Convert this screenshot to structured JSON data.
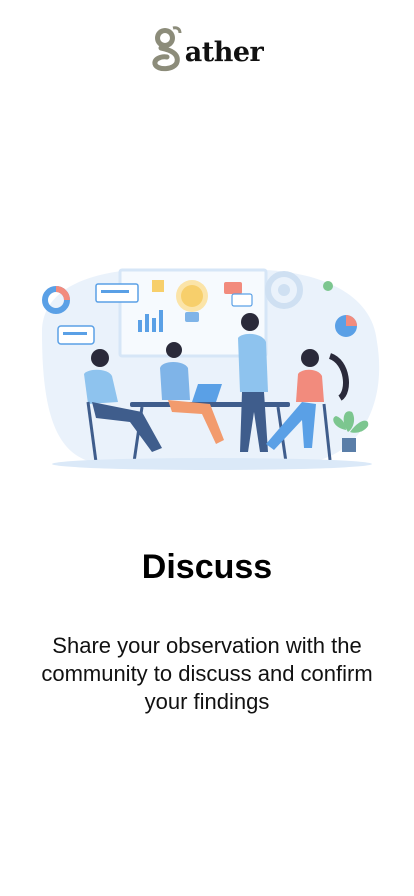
{
  "brand": {
    "logo_text": "ather",
    "logo_icon": "g-letter-logo-icon"
  },
  "onboarding": {
    "title": "Discuss",
    "description": "Share your observation with the community to discuss and confirm your findings",
    "illustration": "team-meeting-illustration"
  },
  "colors": {
    "logo_gray": "#8c8c7a",
    "accent_blue": "#5aa0e6",
    "background": "#ffffff"
  }
}
